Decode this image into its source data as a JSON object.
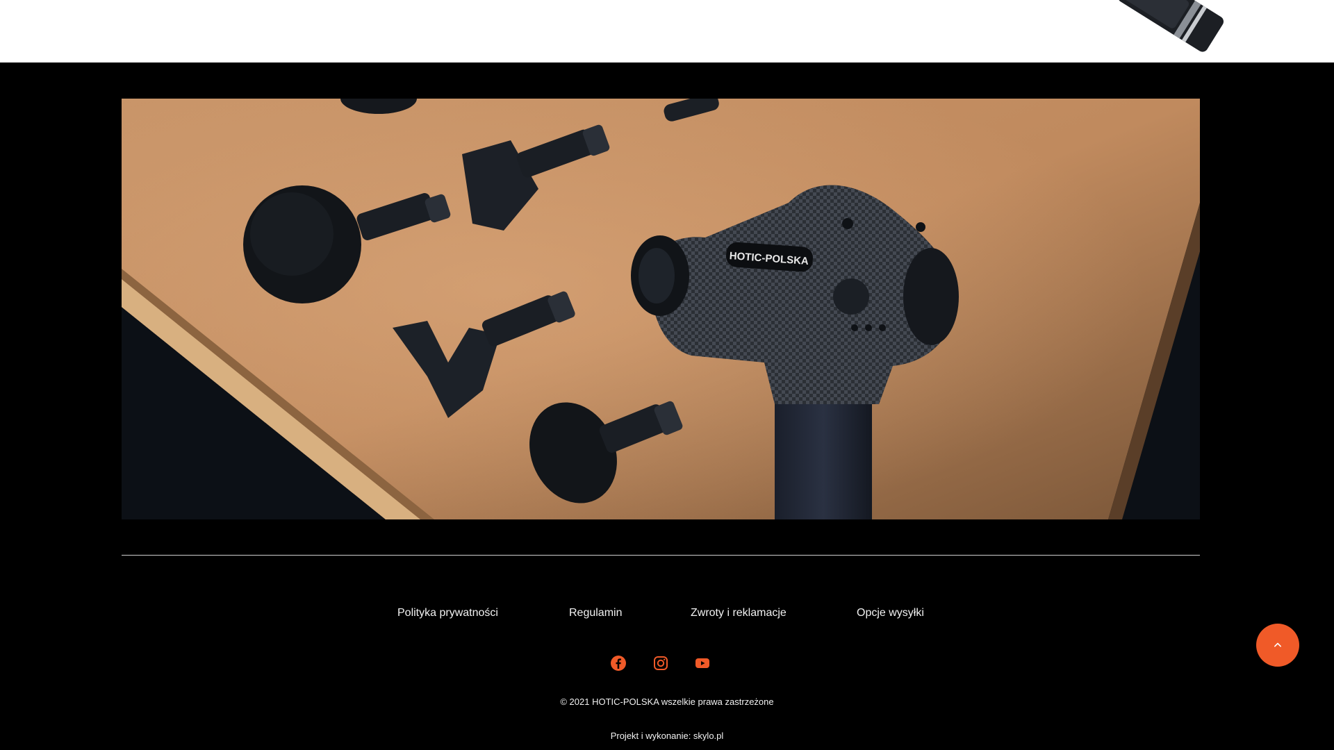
{
  "footer": {
    "links": [
      {
        "label": "Polityka prywatności"
      },
      {
        "label": "Regulamin"
      },
      {
        "label": "Zwroty i reklamacje"
      },
      {
        "label": "Opcje wysyłki"
      }
    ],
    "socials": [
      {
        "icon": "facebook-icon"
      },
      {
        "icon": "instagram-icon"
      },
      {
        "icon": "youtube-icon"
      }
    ],
    "copyright": "© 2021 HOTIC-POLSKA wszelkie prawa zastrzeżone",
    "credits": "Projekt i wykonanie: skylo.pl"
  },
  "banner": {
    "brand_label": "HOTIC-POLSKA"
  },
  "colors": {
    "accent": "#f05a28",
    "background": "#000000",
    "text": "#f2f2f2"
  }
}
